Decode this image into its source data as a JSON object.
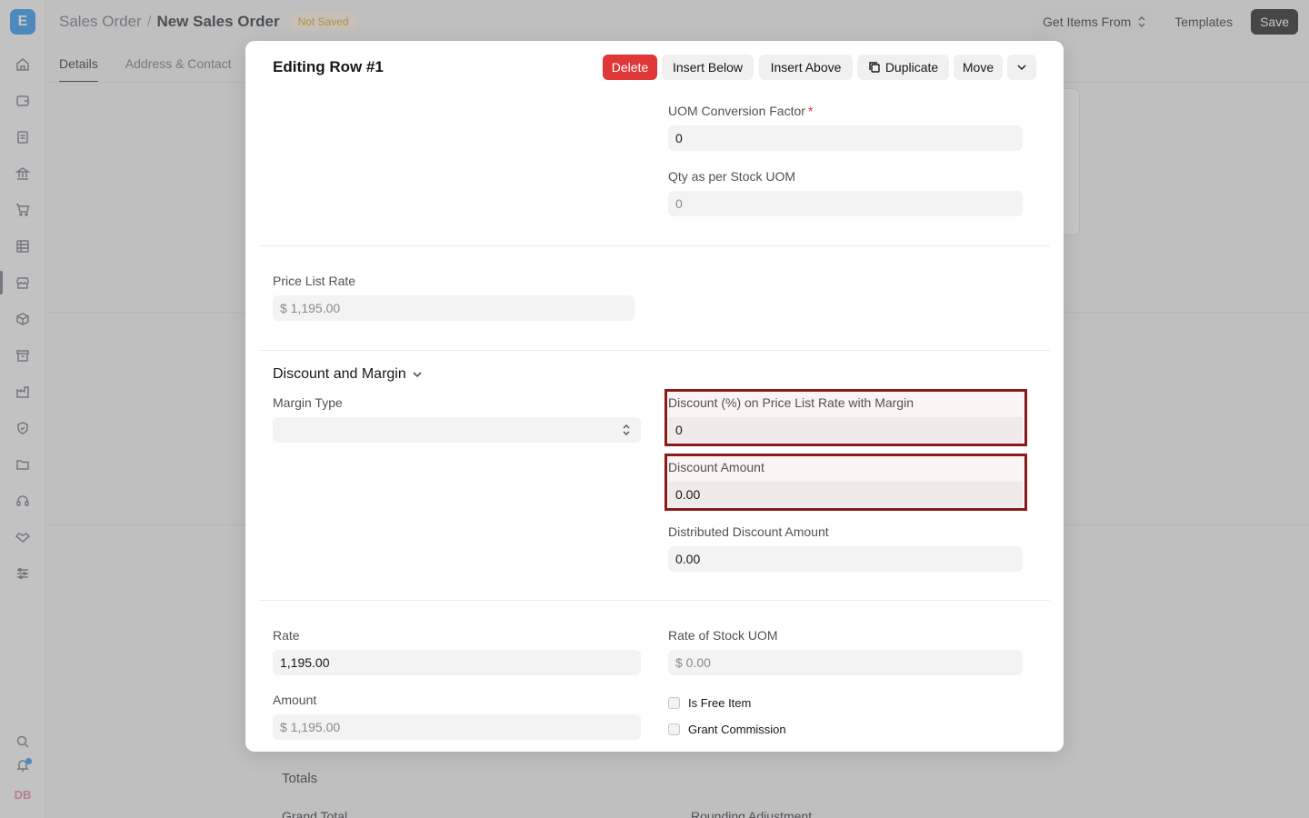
{
  "app": {
    "logo_letter": "E",
    "avatar_initials": "DB"
  },
  "header": {
    "breadcrumb_parent": "Sales Order",
    "breadcrumb_separator": "/",
    "breadcrumb_current": "New Sales Order",
    "status_badge": "Not Saved",
    "get_items_label": "Get Items From",
    "templates_label": "Templates",
    "save_label": "Save"
  },
  "tabs": [
    {
      "label": "Details"
    },
    {
      "label": "Address & Contact"
    }
  ],
  "background": {
    "totals_label": "Totals",
    "grand_total_label": "Grand Total",
    "rounding_label": "Rounding Adjustment"
  },
  "modal": {
    "title": "Editing Row #1",
    "actions": {
      "delete": "Delete",
      "insert_below": "Insert Below",
      "insert_above": "Insert Above",
      "duplicate": "Duplicate",
      "move": "Move"
    },
    "fields": {
      "uom_conversion_factor": {
        "label": "UOM Conversion Factor",
        "required_mark": "*",
        "value": "0"
      },
      "qty_stock_uom": {
        "label": "Qty as per Stock UOM",
        "value": "0"
      },
      "price_list_rate": {
        "label": "Price List Rate",
        "value": "$ 1,195.00"
      },
      "margin_type": {
        "label": "Margin Type",
        "value": ""
      },
      "discount_pct": {
        "label": "Discount (%) on Price List Rate with Margin",
        "value": "0"
      },
      "discount_amount": {
        "label": "Discount Amount",
        "value": "0.00"
      },
      "distributed_discount": {
        "label": "Distributed Discount Amount",
        "value": "0.00"
      },
      "rate": {
        "label": "Rate",
        "value": "1,195.00"
      },
      "rate_stock_uom": {
        "label": "Rate of Stock UOM",
        "value": "$ 0.00"
      },
      "amount": {
        "label": "Amount",
        "value": "$ 1,195.00"
      },
      "is_free_item": {
        "label": "Is Free Item",
        "checked": false
      },
      "grant_commission": {
        "label": "Grant Commission",
        "checked": false
      }
    },
    "section_discount_title": "Discount and Margin"
  },
  "colors": {
    "primary": "#2490ef",
    "danger": "#e03636",
    "highlight_border": "#8b1a1a"
  }
}
